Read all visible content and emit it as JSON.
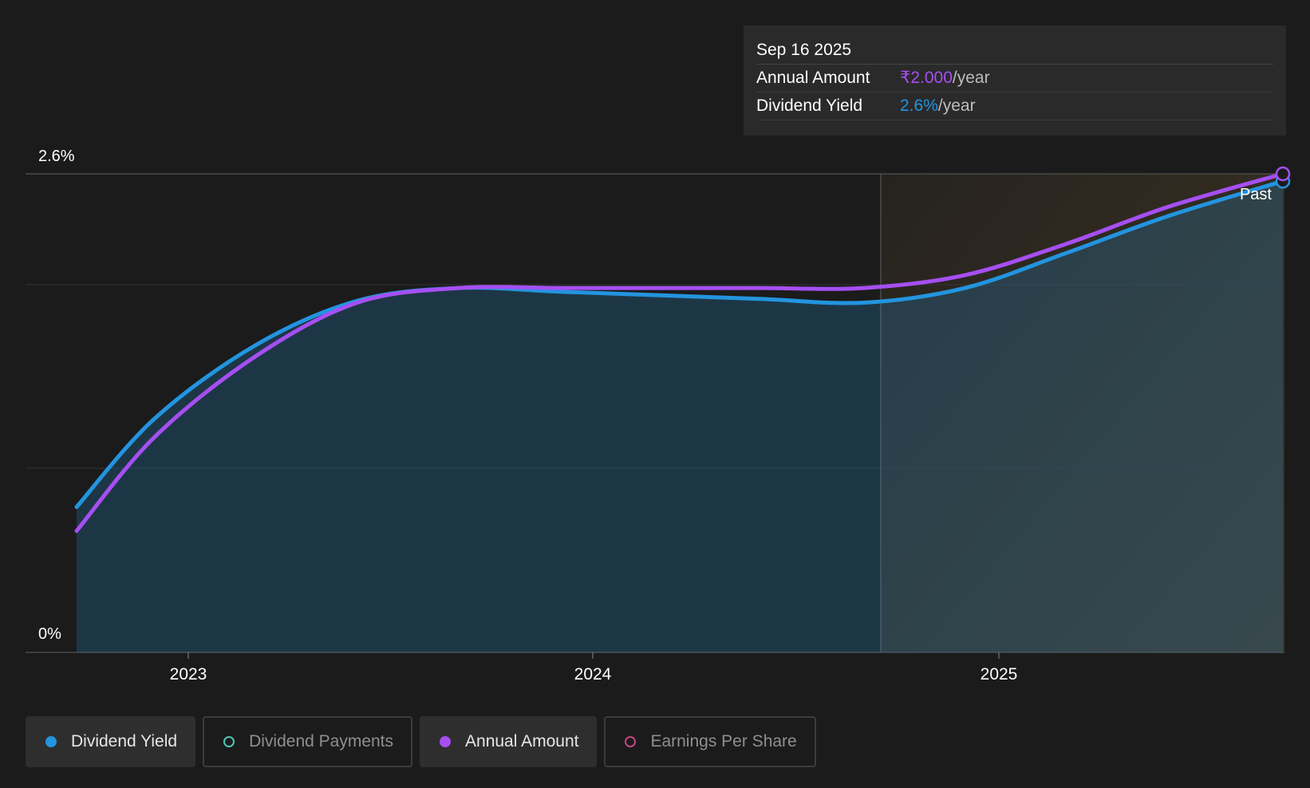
{
  "chart_data": {
    "type": "area",
    "y_axis": {
      "ylim": [
        0,
        2.6
      ],
      "tick_labels": [
        "2.6%",
        "0%"
      ]
    },
    "x_axis": {
      "tick_labels": [
        "2023",
        "2024",
        "2025"
      ]
    },
    "forecast_divider_label": "Past",
    "series": [
      {
        "name": "Dividend Yield",
        "color": "#2394df",
        "x": [
          "2022-09",
          "2022-12",
          "2023-03",
          "2023-06",
          "2023-09",
          "2023-12",
          "2024-03",
          "2024-06",
          "2024-09",
          "2024-12",
          "2025-03",
          "2025-06",
          "2025-09"
        ],
        "values": [
          0.79,
          1.27,
          1.67,
          1.91,
          1.98,
          1.96,
          1.94,
          1.92,
          1.9,
          1.98,
          2.17,
          2.37,
          2.56
        ]
      },
      {
        "name": "Annual Amount",
        "color": "#a54ff2",
        "x": [
          "2022-09",
          "2022-12",
          "2023-03",
          "2023-06",
          "2023-09",
          "2023-12",
          "2024-03",
          "2024-06",
          "2024-09",
          "2024-12",
          "2025-03",
          "2025-06",
          "2025-09"
        ],
        "values": [
          0.66,
          1.17,
          1.61,
          1.9,
          1.98,
          1.98,
          1.98,
          1.98,
          1.98,
          2.05,
          2.22,
          2.42,
          2.6
        ]
      }
    ]
  },
  "tooltip": {
    "date": "Sep 16 2025",
    "rows": [
      {
        "label": "Annual Amount",
        "value": "₹2.000",
        "unit": "/year",
        "color": "#a54ff2"
      },
      {
        "label": "Dividend Yield",
        "value": "2.6%",
        "unit": "/year",
        "color": "#2394df"
      }
    ]
  },
  "legend": [
    {
      "label": "Dividend Yield",
      "color": "#2394df",
      "active": true
    },
    {
      "label": "Dividend Payments",
      "color": "#4fc7b4",
      "active": false
    },
    {
      "label": "Annual Amount",
      "color": "#a54ff2",
      "active": true
    },
    {
      "label": "Earnings Per Share",
      "color": "#c2477f",
      "active": false
    }
  ]
}
